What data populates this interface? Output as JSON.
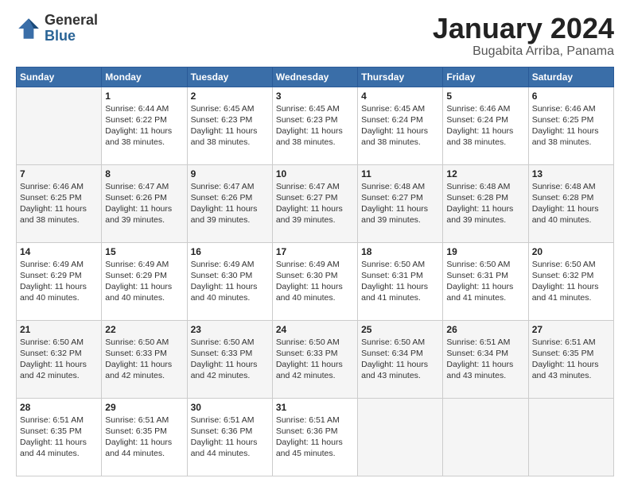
{
  "logo": {
    "general": "General",
    "blue": "Blue"
  },
  "title": {
    "month": "January 2024",
    "location": "Bugabita Arriba, Panama"
  },
  "days_of_week": [
    "Sunday",
    "Monday",
    "Tuesday",
    "Wednesday",
    "Thursday",
    "Friday",
    "Saturday"
  ],
  "weeks": [
    [
      {
        "day": "",
        "sunrise": "",
        "sunset": "",
        "daylight": ""
      },
      {
        "day": "1",
        "sunrise": "Sunrise: 6:44 AM",
        "sunset": "Sunset: 6:22 PM",
        "daylight": "Daylight: 11 hours and 38 minutes."
      },
      {
        "day": "2",
        "sunrise": "Sunrise: 6:45 AM",
        "sunset": "Sunset: 6:23 PM",
        "daylight": "Daylight: 11 hours and 38 minutes."
      },
      {
        "day": "3",
        "sunrise": "Sunrise: 6:45 AM",
        "sunset": "Sunset: 6:23 PM",
        "daylight": "Daylight: 11 hours and 38 minutes."
      },
      {
        "day": "4",
        "sunrise": "Sunrise: 6:45 AM",
        "sunset": "Sunset: 6:24 PM",
        "daylight": "Daylight: 11 hours and 38 minutes."
      },
      {
        "day": "5",
        "sunrise": "Sunrise: 6:46 AM",
        "sunset": "Sunset: 6:24 PM",
        "daylight": "Daylight: 11 hours and 38 minutes."
      },
      {
        "day": "6",
        "sunrise": "Sunrise: 6:46 AM",
        "sunset": "Sunset: 6:25 PM",
        "daylight": "Daylight: 11 hours and 38 minutes."
      }
    ],
    [
      {
        "day": "7",
        "sunrise": "Sunrise: 6:46 AM",
        "sunset": "Sunset: 6:25 PM",
        "daylight": "Daylight: 11 hours and 38 minutes."
      },
      {
        "day": "8",
        "sunrise": "Sunrise: 6:47 AM",
        "sunset": "Sunset: 6:26 PM",
        "daylight": "Daylight: 11 hours and 39 minutes."
      },
      {
        "day": "9",
        "sunrise": "Sunrise: 6:47 AM",
        "sunset": "Sunset: 6:26 PM",
        "daylight": "Daylight: 11 hours and 39 minutes."
      },
      {
        "day": "10",
        "sunrise": "Sunrise: 6:47 AM",
        "sunset": "Sunset: 6:27 PM",
        "daylight": "Daylight: 11 hours and 39 minutes."
      },
      {
        "day": "11",
        "sunrise": "Sunrise: 6:48 AM",
        "sunset": "Sunset: 6:27 PM",
        "daylight": "Daylight: 11 hours and 39 minutes."
      },
      {
        "day": "12",
        "sunrise": "Sunrise: 6:48 AM",
        "sunset": "Sunset: 6:28 PM",
        "daylight": "Daylight: 11 hours and 39 minutes."
      },
      {
        "day": "13",
        "sunrise": "Sunrise: 6:48 AM",
        "sunset": "Sunset: 6:28 PM",
        "daylight": "Daylight: 11 hours and 40 minutes."
      }
    ],
    [
      {
        "day": "14",
        "sunrise": "Sunrise: 6:49 AM",
        "sunset": "Sunset: 6:29 PM",
        "daylight": "Daylight: 11 hours and 40 minutes."
      },
      {
        "day": "15",
        "sunrise": "Sunrise: 6:49 AM",
        "sunset": "Sunset: 6:29 PM",
        "daylight": "Daylight: 11 hours and 40 minutes."
      },
      {
        "day": "16",
        "sunrise": "Sunrise: 6:49 AM",
        "sunset": "Sunset: 6:30 PM",
        "daylight": "Daylight: 11 hours and 40 minutes."
      },
      {
        "day": "17",
        "sunrise": "Sunrise: 6:49 AM",
        "sunset": "Sunset: 6:30 PM",
        "daylight": "Daylight: 11 hours and 40 minutes."
      },
      {
        "day": "18",
        "sunrise": "Sunrise: 6:50 AM",
        "sunset": "Sunset: 6:31 PM",
        "daylight": "Daylight: 11 hours and 41 minutes."
      },
      {
        "day": "19",
        "sunrise": "Sunrise: 6:50 AM",
        "sunset": "Sunset: 6:31 PM",
        "daylight": "Daylight: 11 hours and 41 minutes."
      },
      {
        "day": "20",
        "sunrise": "Sunrise: 6:50 AM",
        "sunset": "Sunset: 6:32 PM",
        "daylight": "Daylight: 11 hours and 41 minutes."
      }
    ],
    [
      {
        "day": "21",
        "sunrise": "Sunrise: 6:50 AM",
        "sunset": "Sunset: 6:32 PM",
        "daylight": "Daylight: 11 hours and 42 minutes."
      },
      {
        "day": "22",
        "sunrise": "Sunrise: 6:50 AM",
        "sunset": "Sunset: 6:33 PM",
        "daylight": "Daylight: 11 hours and 42 minutes."
      },
      {
        "day": "23",
        "sunrise": "Sunrise: 6:50 AM",
        "sunset": "Sunset: 6:33 PM",
        "daylight": "Daylight: 11 hours and 42 minutes."
      },
      {
        "day": "24",
        "sunrise": "Sunrise: 6:50 AM",
        "sunset": "Sunset: 6:33 PM",
        "daylight": "Daylight: 11 hours and 42 minutes."
      },
      {
        "day": "25",
        "sunrise": "Sunrise: 6:50 AM",
        "sunset": "Sunset: 6:34 PM",
        "daylight": "Daylight: 11 hours and 43 minutes."
      },
      {
        "day": "26",
        "sunrise": "Sunrise: 6:51 AM",
        "sunset": "Sunset: 6:34 PM",
        "daylight": "Daylight: 11 hours and 43 minutes."
      },
      {
        "day": "27",
        "sunrise": "Sunrise: 6:51 AM",
        "sunset": "Sunset: 6:35 PM",
        "daylight": "Daylight: 11 hours and 43 minutes."
      }
    ],
    [
      {
        "day": "28",
        "sunrise": "Sunrise: 6:51 AM",
        "sunset": "Sunset: 6:35 PM",
        "daylight": "Daylight: 11 hours and 44 minutes."
      },
      {
        "day": "29",
        "sunrise": "Sunrise: 6:51 AM",
        "sunset": "Sunset: 6:35 PM",
        "daylight": "Daylight: 11 hours and 44 minutes."
      },
      {
        "day": "30",
        "sunrise": "Sunrise: 6:51 AM",
        "sunset": "Sunset: 6:36 PM",
        "daylight": "Daylight: 11 hours and 44 minutes."
      },
      {
        "day": "31",
        "sunrise": "Sunrise: 6:51 AM",
        "sunset": "Sunset: 6:36 PM",
        "daylight": "Daylight: 11 hours and 45 minutes."
      },
      {
        "day": "",
        "sunrise": "",
        "sunset": "",
        "daylight": ""
      },
      {
        "day": "",
        "sunrise": "",
        "sunset": "",
        "daylight": ""
      },
      {
        "day": "",
        "sunrise": "",
        "sunset": "",
        "daylight": ""
      }
    ]
  ]
}
